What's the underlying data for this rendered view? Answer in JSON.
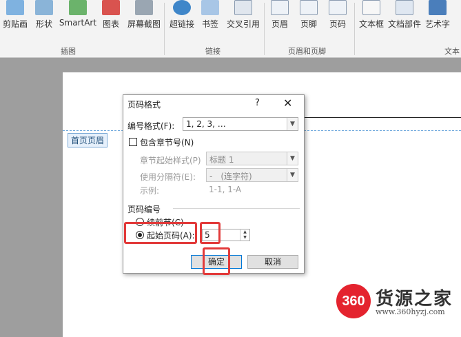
{
  "ribbon": {
    "buttons": [
      {
        "label": "剪贴画"
      },
      {
        "label": "形状"
      },
      {
        "label": "SmartArt"
      },
      {
        "label": "图表"
      },
      {
        "label": "屏幕截图"
      },
      {
        "label": "超链接"
      },
      {
        "label": "书签"
      },
      {
        "label": "交叉引用"
      },
      {
        "label": "页眉"
      },
      {
        "label": "页脚"
      },
      {
        "label": "页码"
      },
      {
        "label": "文本框"
      },
      {
        "label": "文档部件"
      },
      {
        "label": "艺术字"
      }
    ],
    "groups": {
      "illustrations": "插图",
      "links": "链接",
      "header_footer": "页眉和页脚",
      "text": "文本"
    }
  },
  "document": {
    "header_tag": "首页页眉"
  },
  "dialog": {
    "title": "页码格式",
    "help": "?",
    "close": "✕",
    "number_format_label": "编号格式(F):",
    "number_format_value": "1, 2, 3, …",
    "include_chapter_label": "包含章节号(N)",
    "chapter_style_label": "章节起始样式(P)",
    "chapter_style_value": "标题 1",
    "separator_label": "使用分隔符(E):",
    "separator_value": "-　(连字符)",
    "example_label": "示例:",
    "example_value": "1-1, 1-A",
    "page_numbering_label": "页码编号",
    "continue_label": "续前节(C)",
    "start_at_label": "起始页码(A):",
    "start_at_value": "5",
    "ok_label": "确定",
    "cancel_label": "取消"
  },
  "watermark": {
    "logo_text": "360",
    "name": "货源之家",
    "url": "www.360hyzj.com"
  },
  "colors": {
    "highlight": "#e23a3a",
    "accent": "#0078d7"
  }
}
